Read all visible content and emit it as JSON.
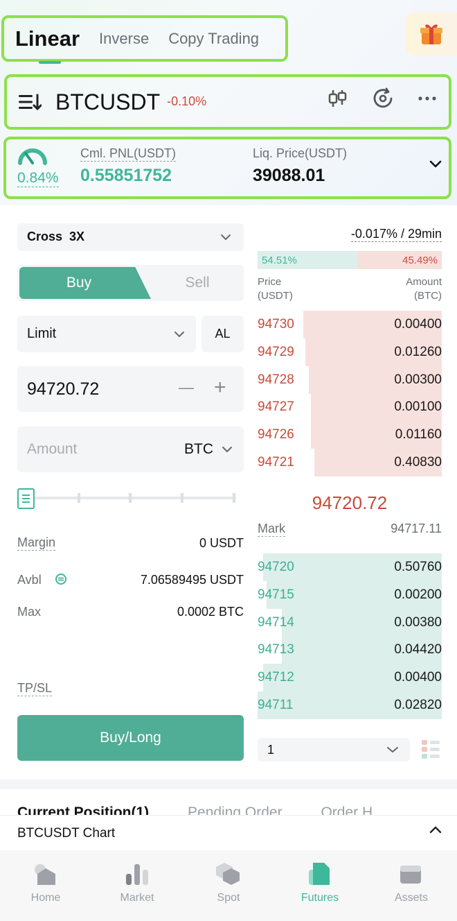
{
  "tabs": [
    {
      "label": "Linear",
      "active": true
    },
    {
      "label": "Inverse",
      "active": false
    },
    {
      "label": "Copy Trading",
      "active": false
    }
  ],
  "pair": {
    "symbol": "BTCUSDT",
    "change": "-0.10%"
  },
  "pnl": {
    "percent": "0.84%",
    "cml_label": "Cml. PNL(USDT)",
    "cml_value": "0.55851752",
    "liq_label": "Liq. Price(USDT)",
    "liq_value": "39088.01"
  },
  "trade": {
    "margin_mode": "Cross",
    "leverage": "3X",
    "buy_label": "Buy",
    "sell_label": "Sell",
    "order_type": "Limit",
    "al_label": "AL",
    "price": "94720.72",
    "minus_glyph": "—",
    "plus_glyph": "+",
    "amount_placeholder": "Amount",
    "amount_unit": "BTC",
    "margin_label": "Margin",
    "margin_value": "0 USDT",
    "avbl_label": "Avbl",
    "avbl_value": "7.06589495 USDT",
    "max_label": "Max",
    "max_value": "0.0002 BTC",
    "tpsl_label": "TP/SL",
    "submit_label": "Buy/Long"
  },
  "orderbook": {
    "funding": "-0.017% / 29min",
    "buy_ratio": "54.51%",
    "sell_ratio": "45.49%",
    "buy_ratio_value": 54.51,
    "price_header": "Price\n(USDT)",
    "amount_header": "Amount\n(BTC)",
    "price_header_l1": "Price",
    "price_header_l2": "(USDT)",
    "amount_header_l1": "Amount",
    "amount_header_l2": "(BTC)",
    "asks": [
      {
        "price": "94730",
        "amount": "0.00400",
        "depth": 0.75
      },
      {
        "price": "94729",
        "amount": "0.01260",
        "depth": 0.74
      },
      {
        "price": "94728",
        "amount": "0.00300",
        "depth": 0.72
      },
      {
        "price": "94727",
        "amount": "0.00100",
        "depth": 0.71
      },
      {
        "price": "94726",
        "amount": "0.01160",
        "depth": 0.71
      },
      {
        "price": "94721",
        "amount": "0.40830",
        "depth": 0.69
      }
    ],
    "last_price": "94720.72",
    "mark_label": "Mark",
    "mark_value": "94717.11",
    "bids": [
      {
        "price": "94720",
        "amount": "0.50760",
        "depth": 0.97
      },
      {
        "price": "94715",
        "amount": "0.00200",
        "depth": 0.95
      },
      {
        "price": "94714",
        "amount": "0.00380",
        "depth": 0.87
      },
      {
        "price": "94713",
        "amount": "0.04420",
        "depth": 0.87
      },
      {
        "price": "94712",
        "amount": "0.00400",
        "depth": 0.97
      },
      {
        "price": "94711",
        "amount": "0.02820",
        "depth": 1.0
      }
    ],
    "precision": "1"
  },
  "positions_tabs": [
    "Current Position(1)",
    "Pending Order",
    "Order H"
  ],
  "chart_bar": {
    "title": "BTCUSDT Chart"
  },
  "nav": [
    {
      "label": "Home",
      "icon": "home-icon",
      "active": false
    },
    {
      "label": "Market",
      "icon": "market-icon",
      "active": false
    },
    {
      "label": "Spot",
      "icon": "spot-icon",
      "active": false
    },
    {
      "label": "Futures",
      "icon": "futures-icon",
      "active": true
    },
    {
      "label": "Assets",
      "icon": "assets-icon",
      "active": false
    }
  ],
  "colors": {
    "accent": "#4fae95",
    "up": "#3fb79a",
    "down": "#d14b3c",
    "highlight": "#8de04b"
  }
}
